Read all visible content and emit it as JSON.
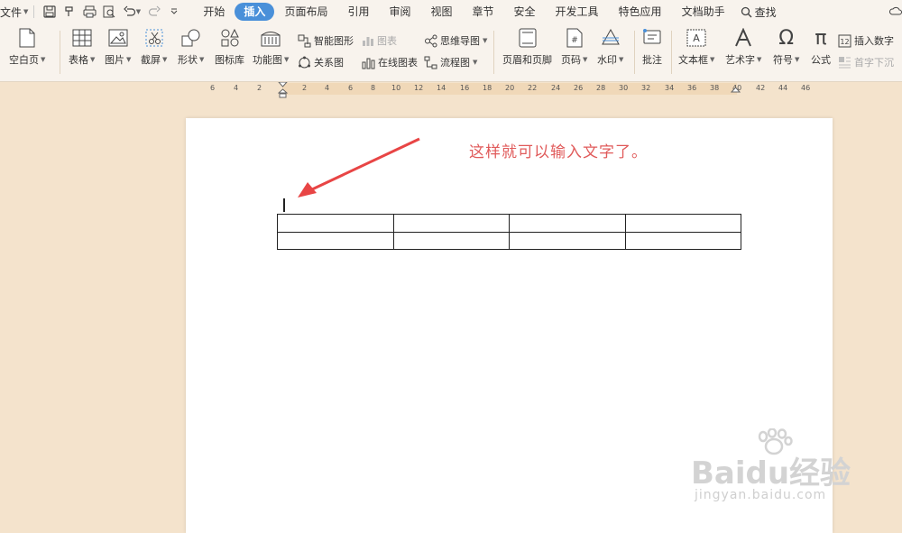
{
  "menubar": {
    "file_label": "文件",
    "tabs": [
      {
        "label": "开始"
      },
      {
        "label": "插入",
        "active": true
      },
      {
        "label": "页面布局"
      },
      {
        "label": "引用"
      },
      {
        "label": "审阅"
      },
      {
        "label": "视图"
      },
      {
        "label": "章节"
      },
      {
        "label": "安全"
      },
      {
        "label": "开发工具"
      },
      {
        "label": "特色应用"
      },
      {
        "label": "文档助手"
      }
    ],
    "search_label": "查找"
  },
  "ribbon": {
    "blank_page": "空白页",
    "table": "表格",
    "picture": "图片",
    "screenshot": "截屏",
    "shape": "形状",
    "icon_lib": "图标库",
    "func_chart": "功能图",
    "smart_shape": "智能图形",
    "chart": "图表",
    "mind_map": "思维导图",
    "relation": "关系图",
    "online_chart": "在线图表",
    "flowchart": "流程图",
    "header_footer": "页眉和页脚",
    "page_num": "页码",
    "watermark": "水印",
    "comment": "批注",
    "textbox": "文本框",
    "wordart": "艺术字",
    "symbol": "符号",
    "formula": "公式",
    "insert_number": "插入数字",
    "drop_cap": "首字下沉"
  },
  "ruler": {
    "ticks": [
      "6",
      "4",
      "2",
      "2",
      "4",
      "6",
      "8",
      "10",
      "12",
      "14",
      "16",
      "18",
      "20",
      "22",
      "24",
      "26",
      "28",
      "30",
      "32",
      "34",
      "36",
      "38",
      "40",
      "42",
      "44",
      "46"
    ]
  },
  "document": {
    "annotation": "这样就可以输入文字了。",
    "table_rows": 2,
    "table_cols": 4
  },
  "watermark": {
    "brand": "Baidu经验",
    "url": "jingyan.baidu.com"
  },
  "colors": {
    "accent": "#4a90d9",
    "annotation_red": "#e05a5a",
    "background": "#f4e3cc"
  }
}
